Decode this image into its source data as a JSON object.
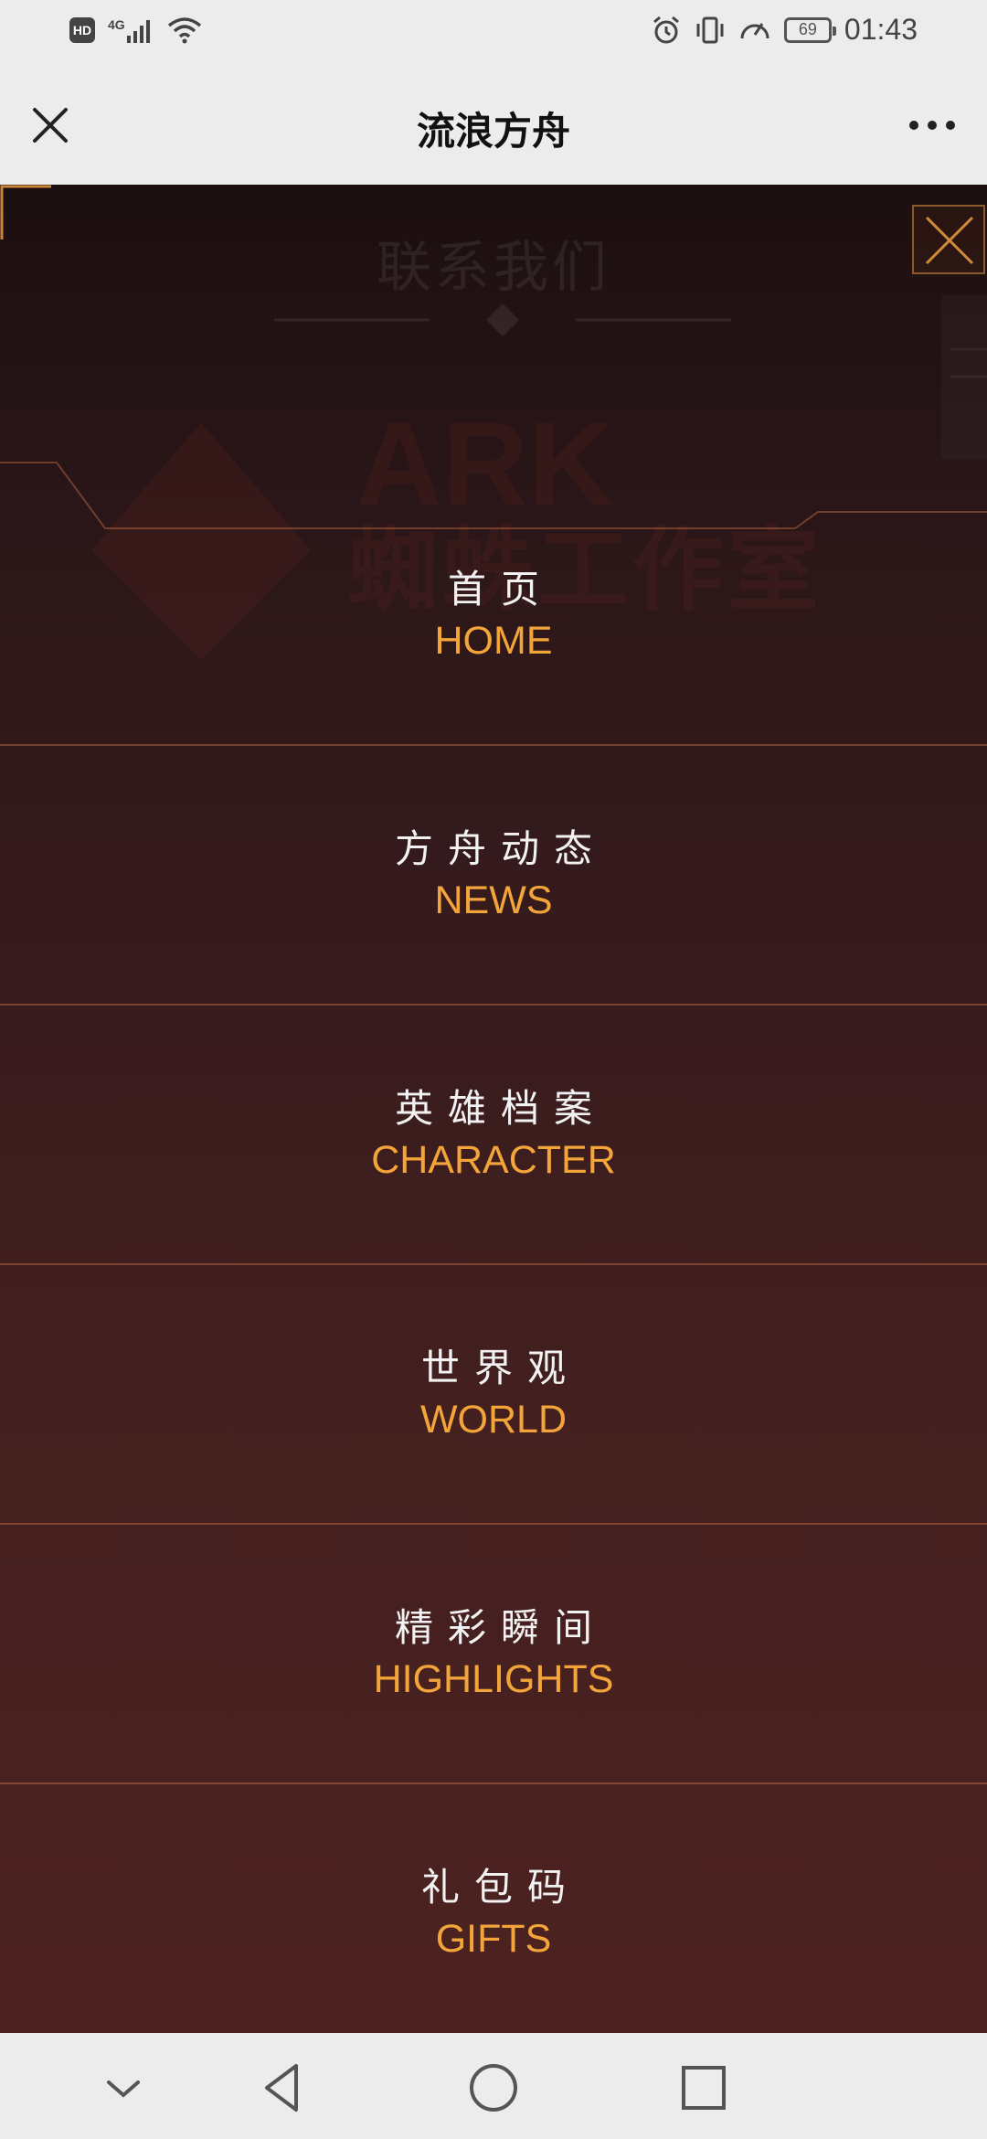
{
  "status_bar": {
    "hd": "HD",
    "network": "4G",
    "battery": "69",
    "time": "01:43"
  },
  "title_bar": {
    "title": "流浪方舟"
  },
  "background": {
    "contact_heading": "联系我们",
    "ark_text": "ARK",
    "studio_text": "蜘蛛工作室"
  },
  "menu": {
    "items": [
      {
        "cn": "首页",
        "en": "HOME"
      },
      {
        "cn": "方舟动态",
        "en": "NEWS"
      },
      {
        "cn": "英雄档案",
        "en": "CHARACTER"
      },
      {
        "cn": "世界观",
        "en": "WORLD"
      },
      {
        "cn": "精彩瞬间",
        "en": "HIGHLIGHTS"
      },
      {
        "cn": "礼包码",
        "en": "GIFTS"
      }
    ]
  },
  "colors": {
    "accent_gold": "#f4a53a",
    "divider": "#c87846"
  },
  "icons": {
    "title_close": "close-icon",
    "title_more": "more-icon",
    "overlay_close": "close-icon",
    "nav_down": "chevron-down-icon",
    "nav_back": "back-triangle-icon",
    "nav_home": "home-circle-icon",
    "nav_recent": "recent-square-icon"
  }
}
